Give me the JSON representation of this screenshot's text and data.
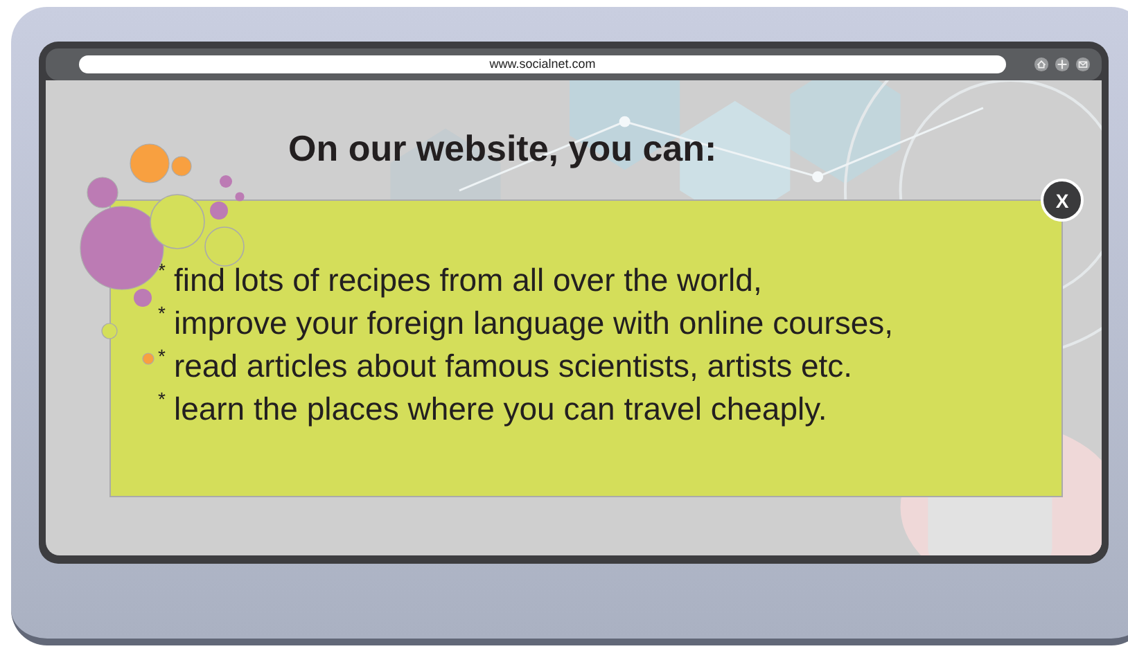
{
  "browser": {
    "url": "www.socialnet.com"
  },
  "heading": "On our website, you can:",
  "close_button": "X",
  "items": [
    {
      "marker": "*",
      "text": "find lots of recipes from all over the world,"
    },
    {
      "marker": "*",
      "text": "improve your foreign language with online courses,"
    },
    {
      "marker": "*",
      "text": "read articles about famous scientists, artists etc."
    },
    {
      "marker": "*",
      "text": "learn the places where you can travel cheaply."
    }
  ]
}
